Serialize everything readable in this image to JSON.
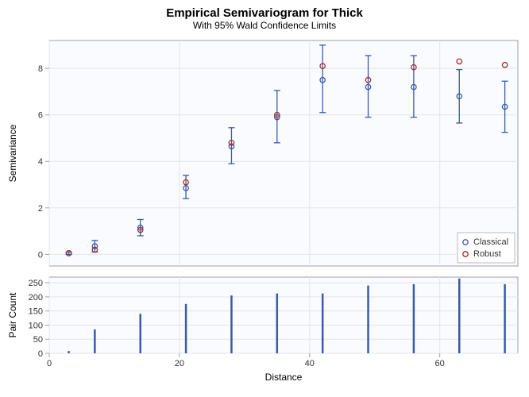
{
  "title": "Empirical Semivariogram for Thick",
  "subtitle": "With 95% Wald Confidence Limits",
  "xlabel": "Distance",
  "ylabel_top": "Semivariance",
  "ylabel_bottom": "Pair Count",
  "legend": {
    "classical": "Classical",
    "robust": "Robust"
  },
  "chart_data": [
    {
      "type": "scatter",
      "title": "Semivariance",
      "xlabel": "Distance",
      "ylabel": "Semivariance",
      "xlim": [
        0,
        72
      ],
      "ylim": [
        -0.5,
        9.2
      ],
      "xticks": [
        0,
        20,
        40,
        60
      ],
      "yticks": [
        0,
        2,
        4,
        6,
        8
      ],
      "x": [
        3,
        7,
        14,
        21,
        28,
        35,
        42,
        49,
        56,
        63,
        70
      ],
      "series": [
        {
          "name": "Classical",
          "color": "#3b5aa8",
          "y": [
            0.05,
            0.35,
            1.15,
            2.85,
            4.65,
            5.9,
            7.5,
            7.2,
            7.2,
            6.8,
            6.35
          ],
          "ci_low": [
            0.0,
            0.1,
            0.8,
            2.4,
            3.9,
            4.8,
            6.1,
            5.9,
            5.9,
            5.65,
            5.25
          ],
          "ci_high": [
            0.1,
            0.6,
            1.5,
            3.4,
            5.45,
            7.05,
            9.0,
            8.55,
            8.55,
            7.95,
            7.45
          ]
        },
        {
          "name": "Robust",
          "color": "#a03028",
          "y": [
            0.05,
            0.2,
            1.05,
            3.1,
            4.8,
            6.0,
            8.1,
            7.5,
            8.05,
            8.3,
            8.15
          ]
        }
      ]
    },
    {
      "type": "bar",
      "title": "Pair Count",
      "xlabel": "Distance",
      "ylabel": "Pair Count",
      "xlim": [
        0,
        72
      ],
      "ylim": [
        0,
        270
      ],
      "yticks": [
        0,
        50,
        100,
        150,
        200,
        250
      ],
      "categories": [
        3,
        7,
        14,
        21,
        28,
        35,
        42,
        49,
        56,
        63,
        70
      ],
      "values": [
        8,
        85,
        140,
        175,
        205,
        212,
        212,
        240,
        245,
        265,
        245
      ]
    }
  ]
}
